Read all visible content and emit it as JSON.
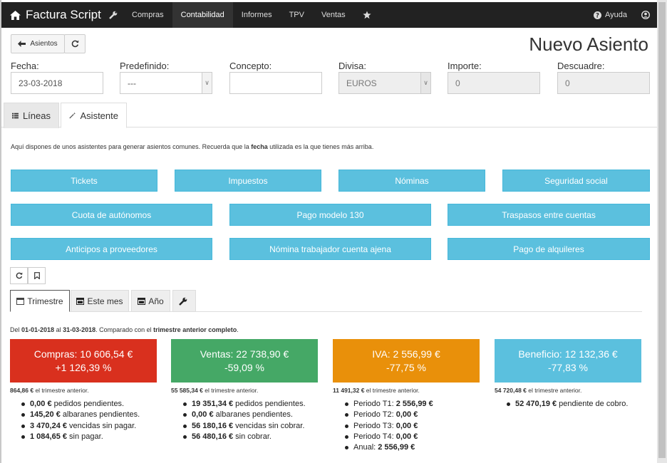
{
  "nav": {
    "brand": "Factura Script",
    "items": [
      "Compras",
      "Contabilidad",
      "Informes",
      "TPV",
      "Ventas"
    ],
    "active": "Contabilidad",
    "help": "Ayuda"
  },
  "toolbar": {
    "back_label": "Asientos"
  },
  "page_title": "Nuevo Asiento",
  "form": {
    "fecha": {
      "label": "Fecha:",
      "value": "23-03-2018"
    },
    "predefinido": {
      "label": "Predefinido:",
      "value": "---"
    },
    "concepto": {
      "label": "Concepto:",
      "value": ""
    },
    "divisa": {
      "label": "Divisa:",
      "value": "EUROS"
    },
    "importe": {
      "label": "Importe:",
      "value": "0"
    },
    "descuadre": {
      "label": "Descuadre:",
      "value": "0"
    }
  },
  "tabs": {
    "lineas": "Líneas",
    "asistente": "Asistente"
  },
  "asistente": {
    "intro_a": "Aquí dispones de unos asistentes para generar asientos comunes. Recuerda que la ",
    "intro_b": "fecha",
    "intro_c": " utilizada es la que tienes más arriba.",
    "buttons": [
      "Tickets",
      "Impuestos",
      "Nóminas",
      "Seguridad social",
      "Cuota de autónomos",
      "Pago modelo 130",
      "Traspasos entre cuentas",
      "Anticipos a proveedores",
      "Nómina trabajador cuenta ajena",
      "Pago de alquileres"
    ]
  },
  "period_tabs": [
    "Trimestre",
    "Este mes",
    "Año"
  ],
  "summary": {
    "a": "Del ",
    "d1": "01-01-2018",
    "b": " al ",
    "d2": "31-03-2018",
    "c": ". Comparado con el ",
    "d3": "trimestre anterior completo",
    "e": "."
  },
  "colors": {
    "red": "#d9301e",
    "green": "#45a866",
    "orange": "#e9900a",
    "blue": "#5bc0de"
  },
  "boxes": [
    {
      "l1": "Compras: 10 606,54 €",
      "l2": "+1 126,39 %",
      "prev_v": "864,86 €",
      "prev_t": " el trimestre anterior.",
      "items": [
        [
          "0,00 €",
          " pedidos pendientes."
        ],
        [
          "145,20 €",
          " albaranes pendientes."
        ],
        [
          "3 470,24 €",
          " vencidas sin pagar."
        ],
        [
          "1 084,65 €",
          " sin pagar."
        ]
      ]
    },
    {
      "l1": "Ventas: 22 738,90 €",
      "l2": "-59,09 %",
      "prev_v": "55 585,34 €",
      "prev_t": " el trimestre anterior.",
      "items": [
        [
          "19 351,34 €",
          " pedidos pendientes."
        ],
        [
          "0,00 €",
          " albaranes pendientes."
        ],
        [
          "56 180,16 €",
          " vencidas sin cobrar."
        ],
        [
          "56 480,16 €",
          " sin cobrar."
        ]
      ]
    },
    {
      "l1": "IVA: 2 556,99 €",
      "l2": "-77,75 %",
      "prev_v": "11 491,32 €",
      "prev_t": " el trimestre anterior.",
      "items": [
        [
          "Periodo T1: ",
          "2 556,99 €"
        ],
        [
          "Periodo T2: ",
          "0,00 €"
        ],
        [
          "Periodo T3: ",
          "0,00 €"
        ],
        [
          "Periodo T4: ",
          "0,00 €"
        ],
        [
          "Anual: ",
          "2 556,99 €"
        ]
      ]
    },
    {
      "l1": "Beneficio: 12 132,36 €",
      "l2": "-77,83 %",
      "prev_v": "54 720,48 €",
      "prev_t": " el trimestre anterior.",
      "items": [
        [
          "52 470,19 €",
          " pendiente de cobro."
        ]
      ]
    }
  ]
}
